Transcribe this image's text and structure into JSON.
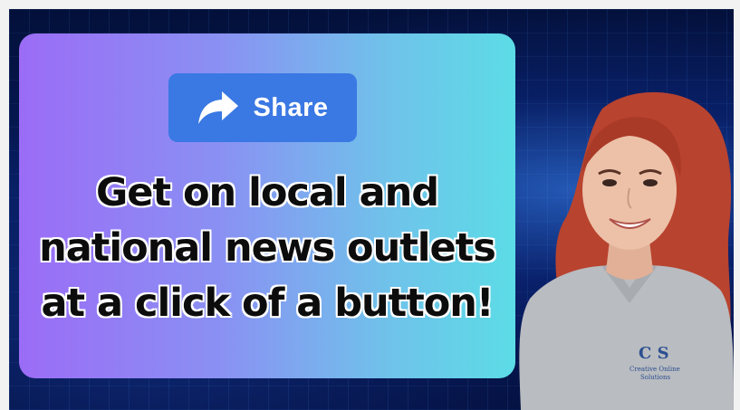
{
  "share_button": {
    "label": "Share",
    "icon": "share-arrow-icon"
  },
  "headline": {
    "line1": "Get on local and",
    "line2": "national news outlets",
    "line3": "at a click of a button!"
  },
  "shirt_logo": {
    "mark": "C S",
    "line1": "Creative Online",
    "line2": "Solutions"
  },
  "colors": {
    "card_start": "#9b6cf6",
    "card_end": "#5cdce6",
    "share_button": "#3a78e3",
    "background": "#061a5a",
    "hair": "#b8432f",
    "shirt": "#b9bcc0"
  }
}
